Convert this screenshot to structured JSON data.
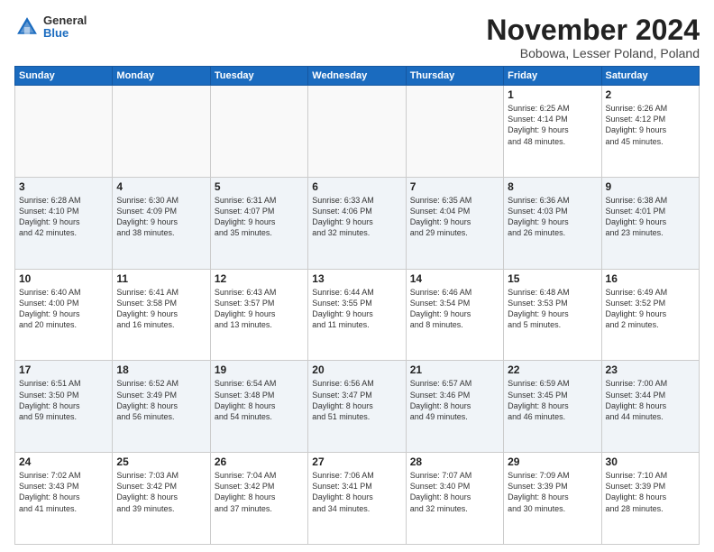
{
  "logo": {
    "general": "General",
    "blue": "Blue"
  },
  "header": {
    "month": "November 2024",
    "location": "Bobowa, Lesser Poland, Poland"
  },
  "weekdays": [
    "Sunday",
    "Monday",
    "Tuesday",
    "Wednesday",
    "Thursday",
    "Friday",
    "Saturday"
  ],
  "weeks": [
    [
      {
        "day": "",
        "info": ""
      },
      {
        "day": "",
        "info": ""
      },
      {
        "day": "",
        "info": ""
      },
      {
        "day": "",
        "info": ""
      },
      {
        "day": "",
        "info": ""
      },
      {
        "day": "1",
        "info": "Sunrise: 6:25 AM\nSunset: 4:14 PM\nDaylight: 9 hours\nand 48 minutes."
      },
      {
        "day": "2",
        "info": "Sunrise: 6:26 AM\nSunset: 4:12 PM\nDaylight: 9 hours\nand 45 minutes."
      }
    ],
    [
      {
        "day": "3",
        "info": "Sunrise: 6:28 AM\nSunset: 4:10 PM\nDaylight: 9 hours\nand 42 minutes."
      },
      {
        "day": "4",
        "info": "Sunrise: 6:30 AM\nSunset: 4:09 PM\nDaylight: 9 hours\nand 38 minutes."
      },
      {
        "day": "5",
        "info": "Sunrise: 6:31 AM\nSunset: 4:07 PM\nDaylight: 9 hours\nand 35 minutes."
      },
      {
        "day": "6",
        "info": "Sunrise: 6:33 AM\nSunset: 4:06 PM\nDaylight: 9 hours\nand 32 minutes."
      },
      {
        "day": "7",
        "info": "Sunrise: 6:35 AM\nSunset: 4:04 PM\nDaylight: 9 hours\nand 29 minutes."
      },
      {
        "day": "8",
        "info": "Sunrise: 6:36 AM\nSunset: 4:03 PM\nDaylight: 9 hours\nand 26 minutes."
      },
      {
        "day": "9",
        "info": "Sunrise: 6:38 AM\nSunset: 4:01 PM\nDaylight: 9 hours\nand 23 minutes."
      }
    ],
    [
      {
        "day": "10",
        "info": "Sunrise: 6:40 AM\nSunset: 4:00 PM\nDaylight: 9 hours\nand 20 minutes."
      },
      {
        "day": "11",
        "info": "Sunrise: 6:41 AM\nSunset: 3:58 PM\nDaylight: 9 hours\nand 16 minutes."
      },
      {
        "day": "12",
        "info": "Sunrise: 6:43 AM\nSunset: 3:57 PM\nDaylight: 9 hours\nand 13 minutes."
      },
      {
        "day": "13",
        "info": "Sunrise: 6:44 AM\nSunset: 3:55 PM\nDaylight: 9 hours\nand 11 minutes."
      },
      {
        "day": "14",
        "info": "Sunrise: 6:46 AM\nSunset: 3:54 PM\nDaylight: 9 hours\nand 8 minutes."
      },
      {
        "day": "15",
        "info": "Sunrise: 6:48 AM\nSunset: 3:53 PM\nDaylight: 9 hours\nand 5 minutes."
      },
      {
        "day": "16",
        "info": "Sunrise: 6:49 AM\nSunset: 3:52 PM\nDaylight: 9 hours\nand 2 minutes."
      }
    ],
    [
      {
        "day": "17",
        "info": "Sunrise: 6:51 AM\nSunset: 3:50 PM\nDaylight: 8 hours\nand 59 minutes."
      },
      {
        "day": "18",
        "info": "Sunrise: 6:52 AM\nSunset: 3:49 PM\nDaylight: 8 hours\nand 56 minutes."
      },
      {
        "day": "19",
        "info": "Sunrise: 6:54 AM\nSunset: 3:48 PM\nDaylight: 8 hours\nand 54 minutes."
      },
      {
        "day": "20",
        "info": "Sunrise: 6:56 AM\nSunset: 3:47 PM\nDaylight: 8 hours\nand 51 minutes."
      },
      {
        "day": "21",
        "info": "Sunrise: 6:57 AM\nSunset: 3:46 PM\nDaylight: 8 hours\nand 49 minutes."
      },
      {
        "day": "22",
        "info": "Sunrise: 6:59 AM\nSunset: 3:45 PM\nDaylight: 8 hours\nand 46 minutes."
      },
      {
        "day": "23",
        "info": "Sunrise: 7:00 AM\nSunset: 3:44 PM\nDaylight: 8 hours\nand 44 minutes."
      }
    ],
    [
      {
        "day": "24",
        "info": "Sunrise: 7:02 AM\nSunset: 3:43 PM\nDaylight: 8 hours\nand 41 minutes."
      },
      {
        "day": "25",
        "info": "Sunrise: 7:03 AM\nSunset: 3:42 PM\nDaylight: 8 hours\nand 39 minutes."
      },
      {
        "day": "26",
        "info": "Sunrise: 7:04 AM\nSunset: 3:42 PM\nDaylight: 8 hours\nand 37 minutes."
      },
      {
        "day": "27",
        "info": "Sunrise: 7:06 AM\nSunset: 3:41 PM\nDaylight: 8 hours\nand 34 minutes."
      },
      {
        "day": "28",
        "info": "Sunrise: 7:07 AM\nSunset: 3:40 PM\nDaylight: 8 hours\nand 32 minutes."
      },
      {
        "day": "29",
        "info": "Sunrise: 7:09 AM\nSunset: 3:39 PM\nDaylight: 8 hours\nand 30 minutes."
      },
      {
        "day": "30",
        "info": "Sunrise: 7:10 AM\nSunset: 3:39 PM\nDaylight: 8 hours\nand 28 minutes."
      }
    ]
  ]
}
